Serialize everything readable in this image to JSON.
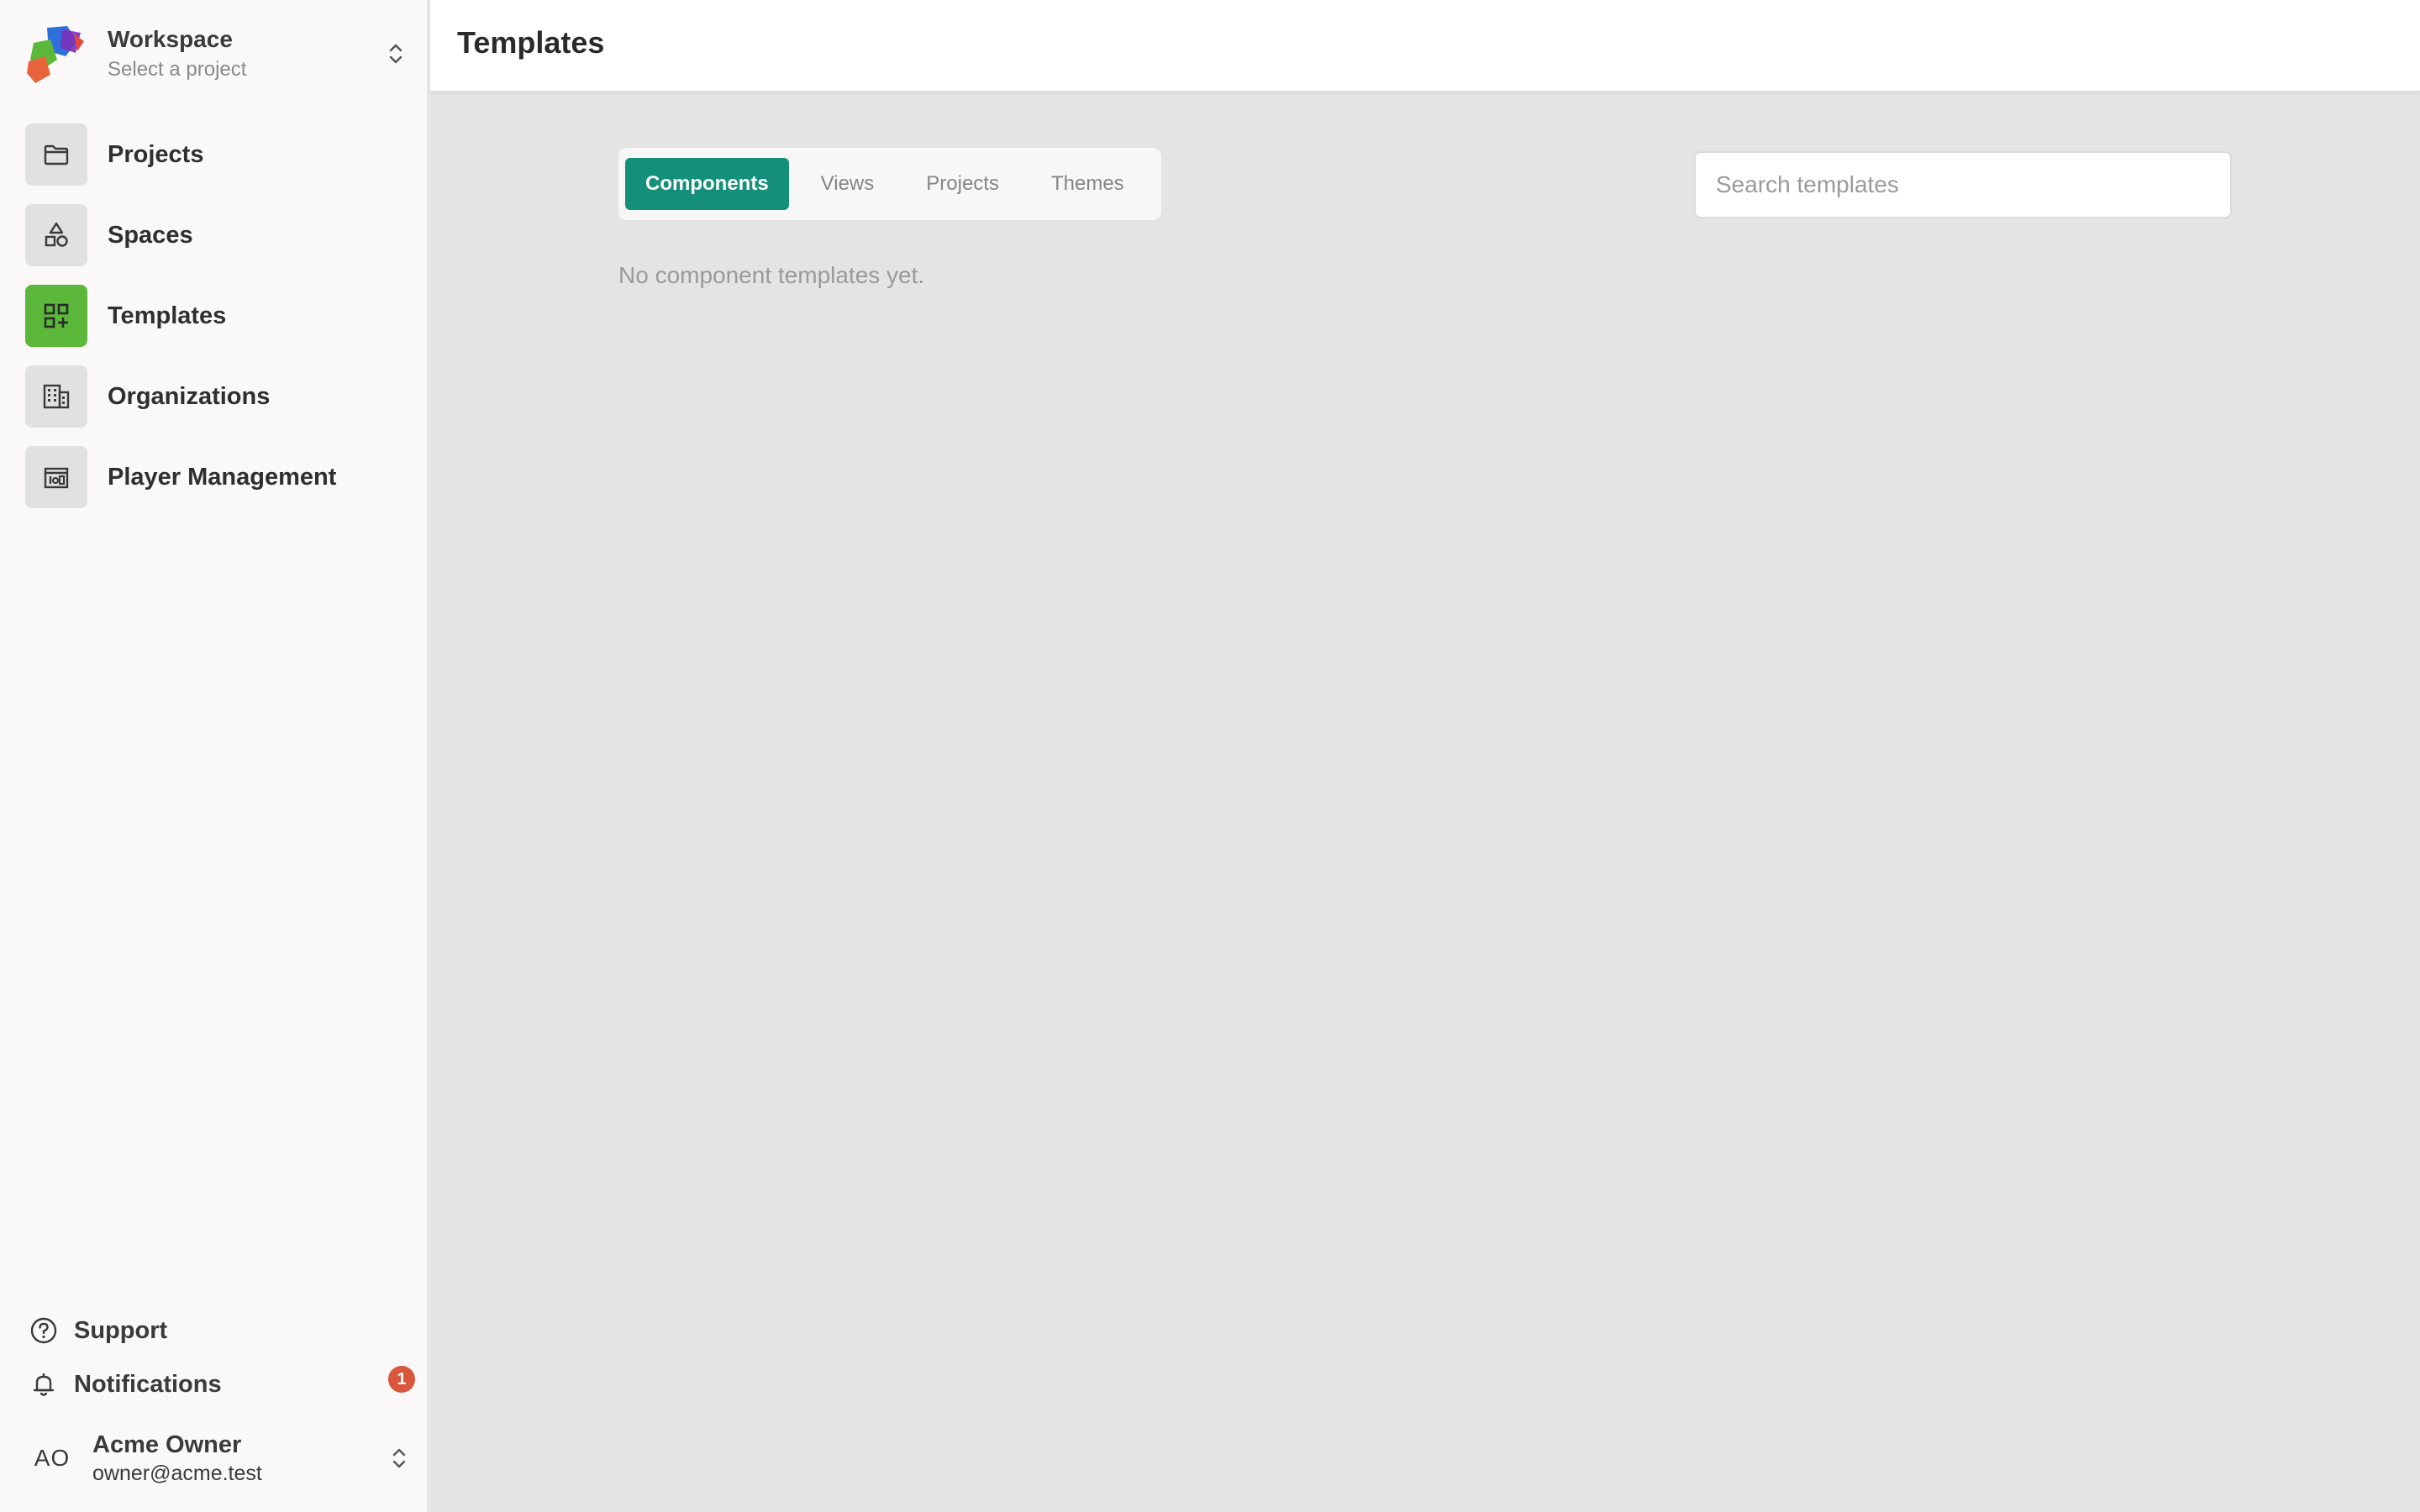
{
  "workspace": {
    "name": "Workspace",
    "subtitle": "Select a project",
    "logo_icon": "colorful-blob-logo",
    "switch_icon": "chevron-up-down-icon"
  },
  "sidebar": {
    "items": [
      {
        "label": "Projects",
        "icon": "folder-icon",
        "active": false
      },
      {
        "label": "Spaces",
        "icon": "shapes-icon",
        "active": false
      },
      {
        "label": "Templates",
        "icon": "grid-plus-icon",
        "active": true
      },
      {
        "label": "Organizations",
        "icon": "building-icon",
        "active": false
      },
      {
        "label": "Player Management",
        "icon": "player-icon",
        "active": false
      }
    ],
    "bottom": {
      "support_label": "Support",
      "notifications_label": "Notifications",
      "notifications_count": "1"
    }
  },
  "user": {
    "initials": "AO",
    "name": "Acme Owner",
    "email": "owner@acme.test"
  },
  "header": {
    "title": "Templates"
  },
  "tabs": [
    {
      "label": "Components",
      "active": true
    },
    {
      "label": "Views",
      "active": false
    },
    {
      "label": "Projects",
      "active": false
    },
    {
      "label": "Themes",
      "active": false
    }
  ],
  "search": {
    "placeholder": "Search templates",
    "value": ""
  },
  "content": {
    "empty_message": "No component templates yet."
  },
  "colors": {
    "active_nav": "#5bb83b",
    "active_tab": "#138f7a",
    "badge": "#d9553b",
    "sidebar_bg": "#faf8f8",
    "main_bg": "#e4e4e4"
  }
}
